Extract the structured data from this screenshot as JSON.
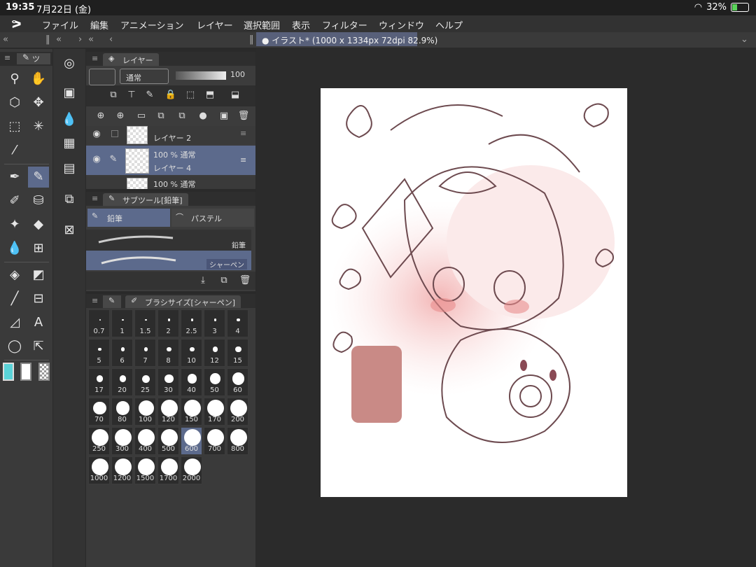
{
  "status": {
    "time": "19:35",
    "date": "7月22日 (金)",
    "battery": "32%",
    "battery_level": 0.32
  },
  "menu": {
    "items": [
      "ファイル",
      "編集",
      "アニメーション",
      "レイヤー",
      "選択範囲",
      "表示",
      "フィルター",
      "ウィンドウ",
      "ヘルプ"
    ]
  },
  "document": {
    "tab_title": "イラスト* (1000 x 1334px 72dpi 82.9%)"
  },
  "tool_panel": {
    "tab_label": "ツ"
  },
  "layer_panel": {
    "title": "レイヤー",
    "blend_mode": "通常",
    "opacity": "100",
    "layers": [
      {
        "name": "レイヤー 2",
        "mode": ""
      },
      {
        "name": "レイヤー 4",
        "mode": "100 %  通常",
        "selected": true
      },
      {
        "name": "",
        "mode": "100 %  通常"
      }
    ]
  },
  "subtool_panel": {
    "title": "サブツール[鉛筆]",
    "tabs": [
      "鉛筆",
      "パステル"
    ],
    "brushes": [
      "鉛筆",
      "シャーペン"
    ]
  },
  "brushsize_panel": {
    "title": "ブラシサイズ[シャーペン]",
    "sizes": [
      "0.7",
      "1",
      "1.5",
      "2",
      "2.5",
      "3",
      "4",
      "5",
      "6",
      "7",
      "8",
      "10",
      "12",
      "15",
      "17",
      "20",
      "25",
      "30",
      "40",
      "50",
      "60",
      "70",
      "80",
      "100",
      "120",
      "150",
      "170",
      "200",
      "250",
      "300",
      "400",
      "500",
      "600",
      "700",
      "800",
      "1000",
      "1200",
      "1500",
      "1700",
      "2000"
    ],
    "selected": "600"
  },
  "colors": {
    "accent": "#5c6a8c",
    "main_color": "#5ad3d8"
  }
}
